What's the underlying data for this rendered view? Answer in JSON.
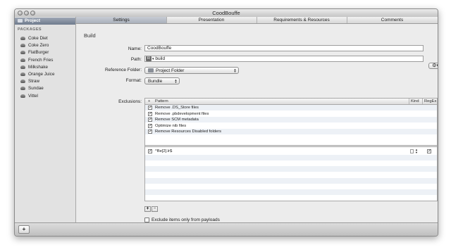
{
  "window": {
    "title": "CoodBouffe"
  },
  "sidebar": {
    "project_label": "Project",
    "section_header": "PACKAGES",
    "packages": [
      "Coke Diet",
      "Coke Zero",
      "FlatBurger",
      "French Fries",
      "Milkshake",
      "Orange Juice",
      "Straw",
      "Sundae",
      "Vittel"
    ]
  },
  "tabs": [
    {
      "label": "Settings",
      "active": true
    },
    {
      "label": "Presentation",
      "active": false
    },
    {
      "label": "Requirements & Resources",
      "active": false
    },
    {
      "label": "Comments",
      "active": false
    }
  ],
  "build": {
    "section_title": "Build",
    "name_label": "Name:",
    "name_value": "CoodBouffe",
    "path_label": "Path:",
    "path_badge": "R",
    "path_value": "build",
    "reference_folder_label": "Reference Folder:",
    "reference_folder_value": "Project Folder",
    "format_label": "Format:",
    "format_value": "Bundle",
    "exclusions_label": "Exclusions:"
  },
  "exclusions": {
    "columns": {
      "sort": "+",
      "pattern": "Pattern",
      "kind": "Kind",
      "regex": "RegEx"
    },
    "presets": [
      {
        "label": "Remove .DS_Store files",
        "checked": true
      },
      {
        "label": "Remove .pbdevelopment files",
        "checked": true
      },
      {
        "label": "Remove SCM metadata",
        "checked": true
      },
      {
        "label": "Optimize nib files",
        "checked": true
      },
      {
        "label": "Remove Resources Disabled folders",
        "checked": true
      }
    ],
    "custom": [
      {
        "pattern": "^Be[2].lr$",
        "checked": true,
        "regex": true
      }
    ]
  },
  "buttons": {
    "add": "+",
    "remove": "−",
    "bottom_add": "+",
    "gear": "⚙▾"
  },
  "exclude_payloads_label": "Exclude items only from payloads"
}
